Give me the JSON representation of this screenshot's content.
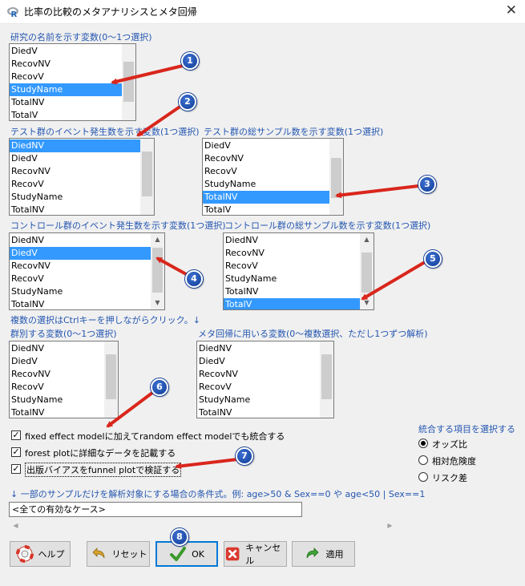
{
  "window": {
    "title": "比率の比較のメタアナリシスとメタ回帰",
    "close_glyph": "✕"
  },
  "sections": {
    "study_name": {
      "label": "研究の名前を示す変数(0〜1つ選択)",
      "items": [
        "DiedV",
        "RecovNV",
        "RecovV",
        "StudyName",
        "TotalNV",
        "TotalV"
      ],
      "selected": 3
    },
    "test_events": {
      "label": "テスト群のイベント発生数を示す変数(1つ選択)",
      "items": [
        "DiedNV",
        "DiedV",
        "RecovNV",
        "RecovV",
        "StudyName",
        "TotalNV"
      ],
      "selected": 0
    },
    "test_total": {
      "label": "テスト群の総サンプル数を示す変数(1つ選択)",
      "items": [
        "DiedV",
        "RecovNV",
        "RecovV",
        "StudyName",
        "TotalNV",
        "TotalV"
      ],
      "selected": 4
    },
    "control_events": {
      "label": "コントロール群のイベント発生数を示す変数(1つ選択)",
      "items": [
        "DiedNV",
        "DiedV",
        "RecovNV",
        "RecovV",
        "StudyName",
        "TotalNV"
      ],
      "selected": 1
    },
    "control_total": {
      "label": "コントロール群の総サンプル数を示す変数(1つ選択)",
      "items": [
        "DiedNV",
        "RecovNV",
        "RecovV",
        "StudyName",
        "TotalNV",
        "TotalV"
      ],
      "selected": 5
    },
    "group": {
      "label": "群別する変数(0〜1つ選択)",
      "items": [
        "DiedNV",
        "DiedV",
        "RecovNV",
        "RecovV",
        "StudyName",
        "TotalNV"
      ],
      "selected": -1
    },
    "meta_regression": {
      "label": "メタ回帰に用いる変数(0〜複数選択、ただし1つずつ解析)",
      "items": [
        "DiedNV",
        "DiedV",
        "RecovNV",
        "RecovV",
        "StudyName",
        "TotalNV"
      ],
      "selected": -1
    }
  },
  "multi_select_note": "複数の選択はCtrlキーを押しながらクリック。↓",
  "checkboxes": [
    {
      "label": "fixed effect modelに加えてrandom effect modelでも統合する",
      "checked": true
    },
    {
      "label": "forest plotに詳細なデータを記載する",
      "checked": true
    },
    {
      "label": "出版バイアスをfunnel plotで検証する",
      "checked": true
    }
  ],
  "effect_measure": {
    "label": "統合する項目を選択する",
    "options": [
      "オッズ比",
      "相対危険度",
      "リスク差"
    ],
    "selected": 0
  },
  "subset": {
    "label": "↓ 一部のサンプルだけを解析対象にする場合の条件式。例: age>50 & Sex==0 や age<50 | Sex==1",
    "value": "<全ての有効なケース>"
  },
  "buttons": {
    "help": "ヘルプ",
    "reset": "リセット",
    "ok": "OK",
    "cancel": "キャンセル",
    "apply": "適用"
  },
  "markers": [
    "1",
    "2",
    "3",
    "4",
    "5",
    "6",
    "7",
    "8"
  ],
  "colors": {
    "accent": "#0078d7",
    "selection": "#3399ff",
    "label_blue": "#2456b0",
    "arrow_red": "#d9261c",
    "marker_blue": "#1d4fb8"
  }
}
